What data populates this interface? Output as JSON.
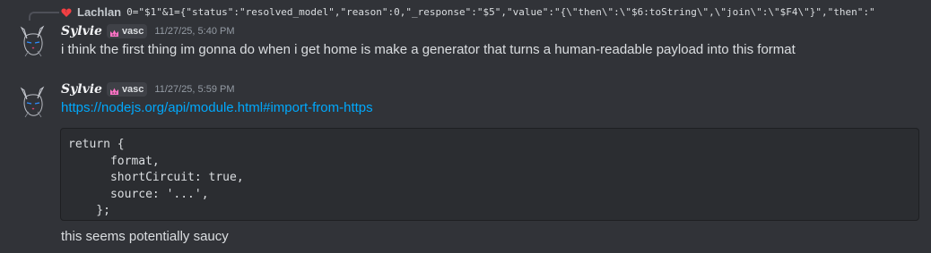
{
  "reply": {
    "icon": "broken-heart-icon",
    "author": "Lachlan",
    "text": "0=\"$1\"&1={\"status\":\"resolved_model\",\"reason\":0,\"_response\":\"$5\",\"value\":\"{\\\"then\\\":\\\"$6:toString\\\",\\\"join\\\":\\\"$F4\\\"}\",\"then\":\""
  },
  "messages": [
    {
      "author": "Sylvie",
      "tag": "vasc",
      "tag_icon": "pink-crown-icon",
      "timestamp": "11/27/25, 5:40 PM",
      "text": "i think the first thing im gonna do when i get home is make a generator that turns a human-readable payload into this format"
    },
    {
      "author": "Sylvie",
      "tag": "vasc",
      "tag_icon": "pink-crown-icon",
      "timestamp": "11/27/25, 5:59 PM",
      "link": "https://nodejs.org/api/module.html#import-from-https",
      "code": [
        "return {",
        "      format,",
        "      shortCircuit: true,",
        "      source: '...',",
        "    };"
      ],
      "text": "this seems potentially saucy"
    }
  ],
  "colors": {
    "background": "#313338",
    "link": "#00a8fc",
    "code_background": "#2b2d31",
    "tag_icon": "#ff73c6"
  }
}
